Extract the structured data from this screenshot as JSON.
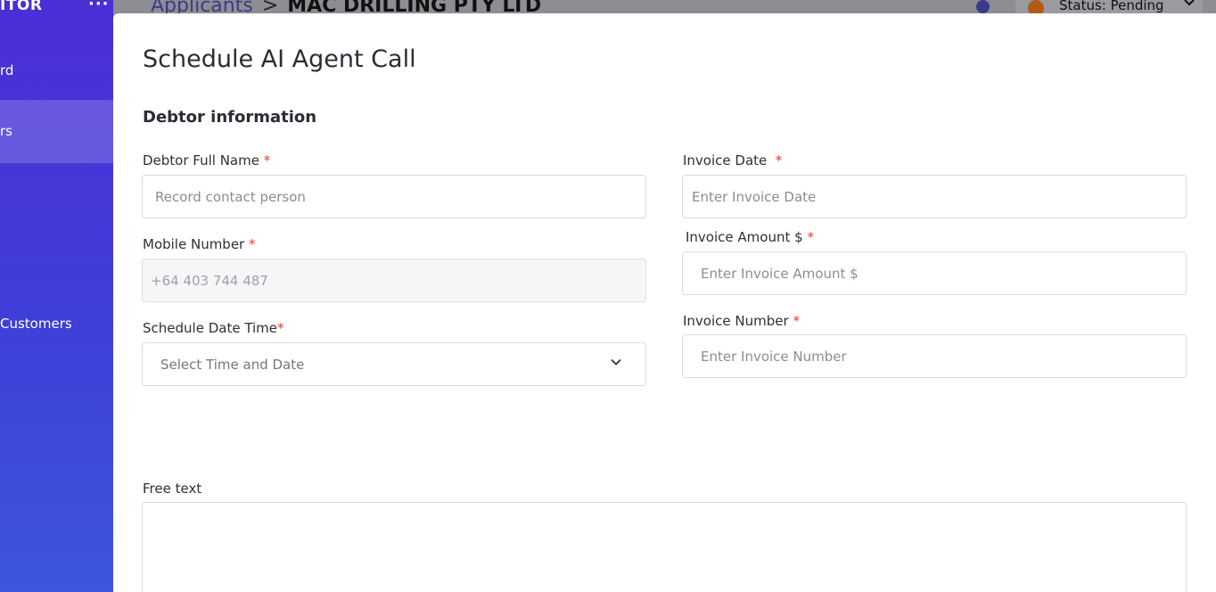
{
  "sidebar": {
    "brand": "ITOR",
    "menu_dots": "···",
    "items": [
      {
        "label": "rd"
      },
      {
        "label": "rs"
      },
      {
        "label": ""
      },
      {
        "label": ""
      },
      {
        "label": "Customers"
      }
    ]
  },
  "header": {
    "breadcrumb_parent": "Applicants",
    "breadcrumb_separator": ">",
    "breadcrumb_current": "MAC DRILLING PTY LTD",
    "status_label": "Status: Pending",
    "colors": {
      "status_dot": "#b25a17",
      "info_dot": "#3a3a8a"
    }
  },
  "modal": {
    "title": "Schedule AI Agent Call",
    "section_title": "Debtor  information",
    "fields": {
      "debtor_name": {
        "label": "Debtor Full Name",
        "required": "*",
        "placeholder": "Record contact person",
        "value": ""
      },
      "mobile": {
        "label": "Mobile Number",
        "required": "*",
        "placeholder": "+64 403 744 487",
        "value": ""
      },
      "schedule": {
        "label": "Schedule Date Time",
        "required": "*",
        "placeholder": "Select Time and Date",
        "icon": "chevron-down-icon"
      },
      "invoice_date": {
        "label": "Invoice Date",
        "required": "*",
        "placeholder": "Enter Invoice Date",
        "value": ""
      },
      "invoice_amount": {
        "label": "Invoice Amount $",
        "required": "*",
        "placeholder": "Enter Invoice Amount $",
        "value": ""
      },
      "invoice_number": {
        "label": "Invoice Number",
        "required": "*",
        "placeholder": "Enter Invoice Number",
        "value": ""
      },
      "free_text": {
        "label": "Free text",
        "value": ""
      }
    },
    "colors": {
      "required": "#e23b3b",
      "accent": "#4b2ed6"
    }
  }
}
